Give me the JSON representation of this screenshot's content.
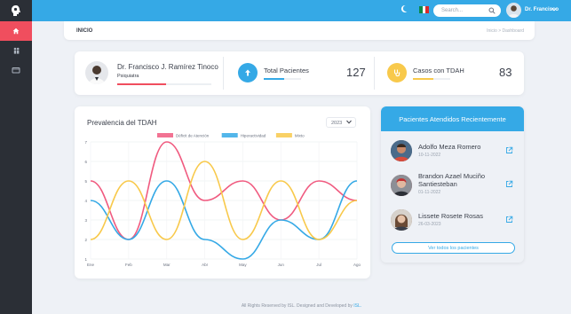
{
  "colors": {
    "primary": "#35a9e6",
    "danger": "#f04e5e",
    "warning": "#f8c94b",
    "sidebar": "#2b2f36"
  },
  "sidebar": {
    "items": [
      {
        "icon": "home-icon",
        "active": true
      },
      {
        "icon": "users-icon",
        "active": false
      },
      {
        "icon": "card-icon",
        "active": false
      }
    ]
  },
  "topbar": {
    "search_placeholder": "Search...",
    "user_name": "Dr. Francisco"
  },
  "breadcrumb": {
    "title": "INICIO",
    "path": "Inicio  >  Dashboard"
  },
  "doctor": {
    "name": "Dr. Francisco J. Ramírez Tinoco",
    "role": "Psiquiatra",
    "progress": 0.52
  },
  "stats": [
    {
      "label": "Total Pacientes",
      "value": "127",
      "color": "#35a9e6",
      "icon": "upload-arrow-icon",
      "progress": 0.55
    },
    {
      "label": "Casos con TDAH",
      "value": "83",
      "color": "#f8c94b",
      "icon": "stethoscope-icon",
      "progress": 0.55
    }
  ],
  "chart": {
    "year": "2023"
  },
  "chart_data": {
    "type": "line",
    "title": "Prevalencia del TDAH",
    "categories": [
      "Ene",
      "Feb",
      "Mar",
      "Abr",
      "May",
      "Jun",
      "Jul",
      "Ago"
    ],
    "ylim": [
      1,
      7
    ],
    "yticks": [
      1,
      2,
      3,
      4,
      5,
      6,
      7
    ],
    "legend_position": "top",
    "series": [
      {
        "name": "Déficit de Atención",
        "color": "#f05b80",
        "values": [
          5,
          2,
          7,
          4,
          5,
          3,
          5,
          4
        ]
      },
      {
        "name": "Hiperactividad",
        "color": "#35a9e6",
        "values": [
          4,
          2,
          5,
          2,
          1,
          3,
          2,
          5
        ]
      },
      {
        "name": "Mixto",
        "color": "#f8c94b",
        "values": [
          2,
          5,
          2,
          6,
          2,
          5,
          2,
          4
        ]
      }
    ]
  },
  "patients": {
    "title": "Pacientes Atendidos Recientemente",
    "items": [
      {
        "name": "Adolfo Meza Romero",
        "date": "10-11-2022"
      },
      {
        "name": "Brandon Azael Muciño Santiesteban",
        "date": "01-11-2022"
      },
      {
        "name": "Lissete Rosete Rosas",
        "date": "26-03-2023"
      }
    ],
    "see_all": "Ver todos los pacientes"
  },
  "footer": {
    "text": "All Rights Reserved by ISL. Designed and Developed by",
    "link": "ISL."
  }
}
